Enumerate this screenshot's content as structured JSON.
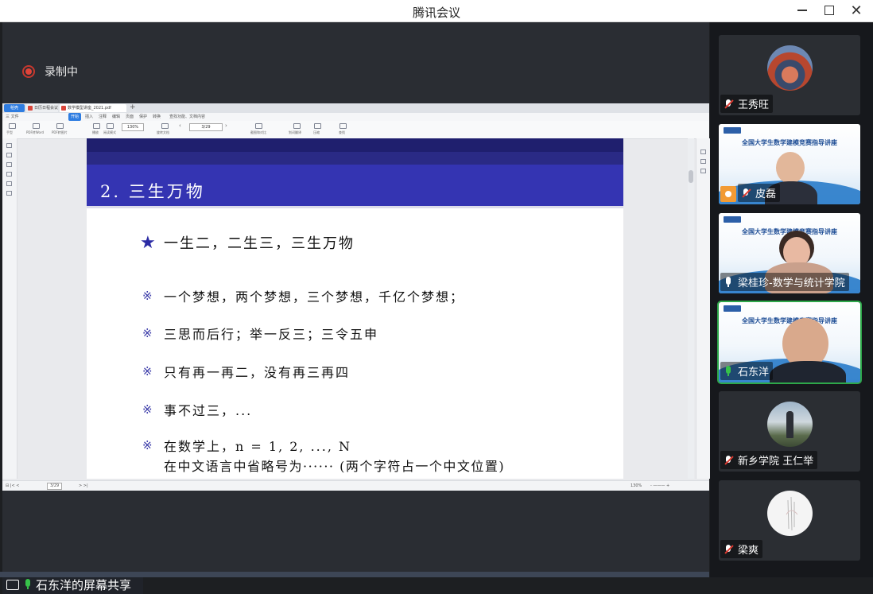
{
  "window": {
    "title": "腾讯会议"
  },
  "recording": {
    "label": "录制中"
  },
  "pdf": {
    "tabs": [
      "稻壳",
      "日历日程会议",
      "数学模型讲座_2021.pdf"
    ],
    "menu": [
      "三 文件",
      "开始",
      "插入",
      "注释",
      "编辑",
      "页面",
      "保护",
      "转换",
      "查找功能、文档内容"
    ],
    "ribbon_labels": [
      "手型",
      "选择",
      "PDF转Word",
      "PDF转图片",
      "播放",
      "阅读模式",
      "旋转文档",
      "上一页",
      "下一页",
      "截图和对比",
      "划词翻译",
      "压缩",
      "查找"
    ],
    "zoom": "130%",
    "page_indicator": "3/29",
    "status_zoom": "130%"
  },
  "slide": {
    "title": "2. 三生万物",
    "highlight": "一生二，二生三，三生万物",
    "bullet_marker": "※",
    "bullets": [
      "一个梦想，两个梦想，三个梦想，千亿个梦想；",
      "三思而后行；举一反三；三令五申",
      "只有再一再二，没有再三再四",
      "事不过三，...",
      "在数学上，n = 1, 2, ..., N"
    ],
    "bullet5_line2": "在中文语言中省略号为······ (两个字符占一个中文位置)"
  },
  "share": {
    "owner_label": "石东洋的屏幕共享"
  },
  "participants": [
    {
      "name": "王秀旺",
      "mic": "muted"
    },
    {
      "name": "皮磊",
      "mic": "muted",
      "host": true,
      "slide_title": "全国大学生数学建模竞赛指导讲座"
    },
    {
      "name": "梁桂珍-数学与统计学院",
      "mic": "on",
      "slide_title": "全国大学生数学建模竞赛指导讲座"
    },
    {
      "name": "石东洋",
      "mic": "speaking",
      "slide_title": "全国大学生数学建模竞赛指导讲座"
    },
    {
      "name": "新乡学院 王仁举",
      "mic": "muted"
    },
    {
      "name": "梁爽",
      "mic": "muted"
    }
  ],
  "colors": {
    "slide_header": "#3434b2",
    "accent_green": "#37c24a",
    "recording_red": "#e0443a",
    "muted_red": "#e03c32"
  }
}
